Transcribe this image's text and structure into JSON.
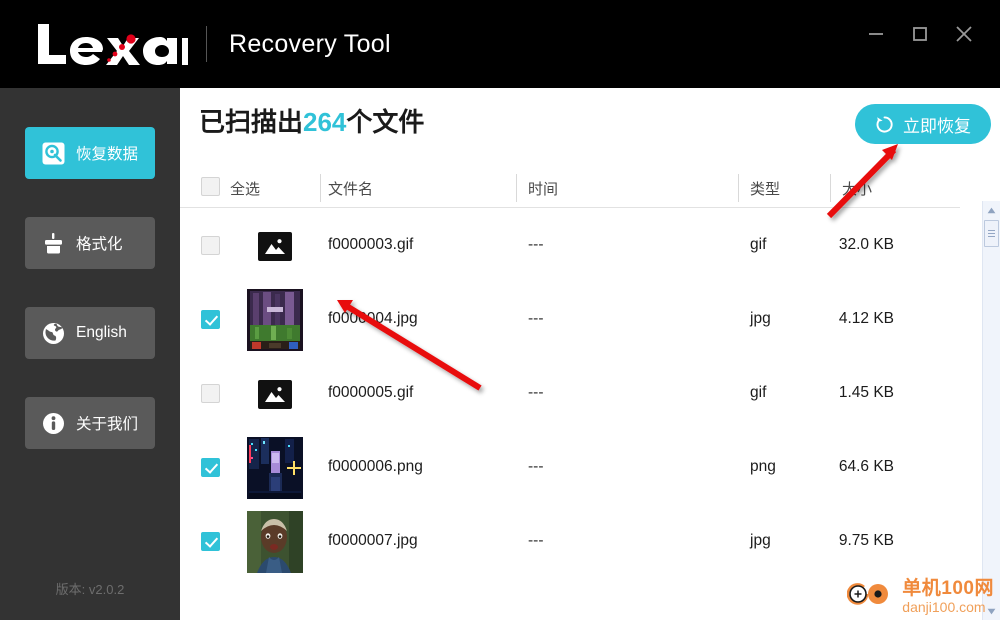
{
  "window": {
    "brand": "Lexar",
    "subtitle": "Recovery Tool",
    "controls": {
      "minimize": "minimize-button",
      "maximize": "maximize-button",
      "close": "close-button"
    }
  },
  "sidebar": {
    "items": [
      {
        "label": "恢复数据",
        "icon": "hard-drive-icon",
        "active": true
      },
      {
        "label": "格式化",
        "icon": "format-disk-icon",
        "active": false
      },
      {
        "label": "English",
        "icon": "globe-icon",
        "active": false
      },
      {
        "label": "关于我们",
        "icon": "info-icon",
        "active": false
      }
    ],
    "version": "版本: v2.0.2",
    "active_color": "#30c2d8",
    "item_color": "#5a5a5a",
    "background": "#333333"
  },
  "main": {
    "scan_title_prefix": "已扫描出",
    "scan_count": "264",
    "scan_title_suffix": "个文件",
    "recover_button": "立即恢复",
    "accent_color": "#30c2d8",
    "table": {
      "headers": {
        "select_all": "全选",
        "filename": "文件名",
        "time": "时间",
        "type": "类型",
        "size": "大小"
      },
      "rows": [
        {
          "checked": false,
          "thumb": "placeholder",
          "filename": "f0000003.gif",
          "time": "---",
          "type": "gif",
          "size": "32.0 KB"
        },
        {
          "checked": true,
          "thumb": "forest-scene",
          "filename": "f0000004.jpg",
          "time": "---",
          "type": "jpg",
          "size": "4.12 KB"
        },
        {
          "checked": false,
          "thumb": "placeholder",
          "filename": "f0000005.gif",
          "time": "---",
          "type": "gif",
          "size": "1.45 KB"
        },
        {
          "checked": true,
          "thumb": "neon-city",
          "filename": "f0000006.png",
          "time": "---",
          "type": "png",
          "size": "64.6 KB"
        },
        {
          "checked": true,
          "thumb": "portrait",
          "filename": "f0000007.jpg",
          "time": "---",
          "type": "jpg",
          "size": "9.75 KB"
        }
      ],
      "select_all_checked": false
    }
  },
  "watermark": {
    "cn": "单机100网",
    "en": "danji100.com",
    "color": "#f08a3c"
  }
}
